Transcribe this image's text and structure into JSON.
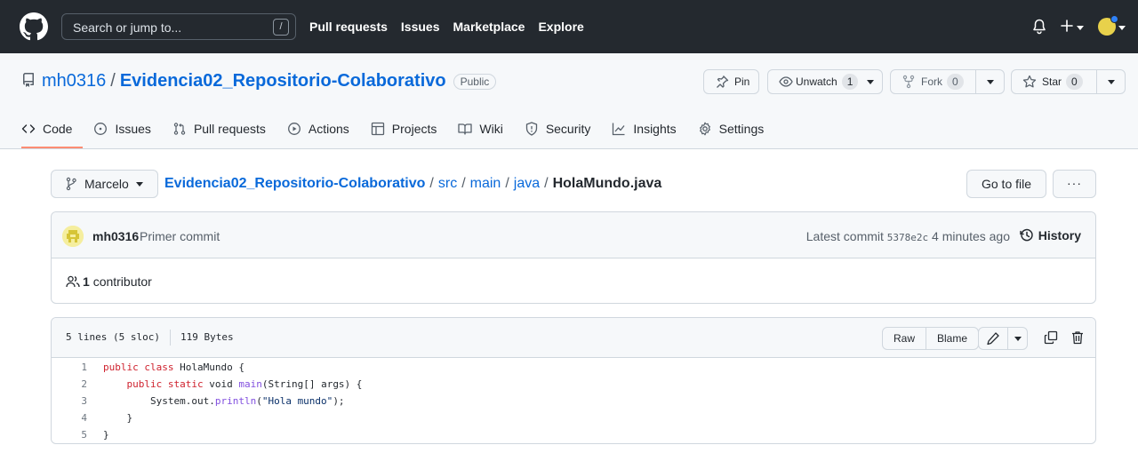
{
  "topbar": {
    "search_placeholder": "Search or jump to...",
    "search_shortcut": "/",
    "nav": [
      "Pull requests",
      "Issues",
      "Marketplace",
      "Explore"
    ],
    "icons": [
      "github-logo-icon",
      "bell-icon",
      "plus-icon",
      "avatar"
    ]
  },
  "repo": {
    "owner": "mh0316",
    "separator": "/",
    "name": "Evidencia02_Repositorio-Colaborativo",
    "visibility": "Public",
    "pin_label": "Pin",
    "unwatch_label": "Unwatch",
    "watch_count": "1",
    "fork_label": "Fork",
    "fork_count": "0",
    "star_label": "Star",
    "star_count": "0"
  },
  "tabs": [
    {
      "label": "Code",
      "icon": "code-icon",
      "active": true
    },
    {
      "label": "Issues",
      "icon": "issue-icon"
    },
    {
      "label": "Pull requests",
      "icon": "pull-request-icon"
    },
    {
      "label": "Actions",
      "icon": "play-icon"
    },
    {
      "label": "Projects",
      "icon": "table-icon"
    },
    {
      "label": "Wiki",
      "icon": "book-icon"
    },
    {
      "label": "Security",
      "icon": "shield-icon"
    },
    {
      "label": "Insights",
      "icon": "graph-icon"
    },
    {
      "label": "Settings",
      "icon": "gear-icon"
    }
  ],
  "filenav": {
    "branch": "Marcelo",
    "path": [
      "Evidencia02_Repositorio-Colaborativo",
      "src",
      "main",
      "java"
    ],
    "file": "HolaMundo.java",
    "go_to_file": "Go to file",
    "more": "···"
  },
  "commit": {
    "author": "mh0316",
    "message": "Primer commit",
    "latest_label": "Latest commit",
    "sha": "5378e2c",
    "time": "4 minutes ago",
    "history_label": "History",
    "contributors_count": "1",
    "contributors_label": "contributor"
  },
  "file": {
    "lines_info": "5 lines (5 sloc)",
    "size": "119 Bytes",
    "raw_label": "Raw",
    "blame_label": "Blame",
    "lines": [
      {
        "n": "1",
        "text": "public class HolaMundo {"
      },
      {
        "n": "2",
        "text": "    public static void main(String[] args) {"
      },
      {
        "n": "3",
        "text": "        System.out.println(\"Hola mundo\");"
      },
      {
        "n": "4",
        "text": "    }"
      },
      {
        "n": "5",
        "text": "}"
      }
    ]
  },
  "colors": {
    "header_bg": "#24292f",
    "link": "#0969da",
    "active_tab_underline": "#fd8c73",
    "keyword": "#cf222e",
    "function": "#8250df",
    "string": "#0a3069"
  }
}
